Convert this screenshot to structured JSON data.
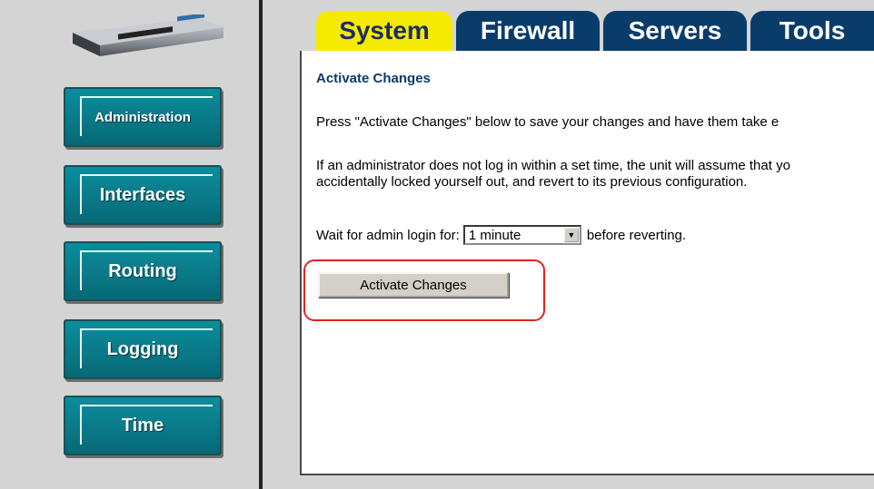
{
  "sidebar": {
    "items": [
      {
        "label": "Administration"
      },
      {
        "label": "Interfaces"
      },
      {
        "label": "Routing"
      },
      {
        "label": "Logging"
      },
      {
        "label": "Time"
      }
    ]
  },
  "tabs": [
    {
      "label": "System",
      "active": true
    },
    {
      "label": "Firewall",
      "active": false
    },
    {
      "label": "Servers",
      "active": false
    },
    {
      "label": "Tools",
      "active": false
    }
  ],
  "main": {
    "heading": "Activate Changes",
    "paragraph1": "Press \"Activate Changes\" below to save your changes and have them take e",
    "paragraph2_line1": "If an administrator does not log in within a set time, the unit will assume that yo",
    "paragraph2_line2": "accidentally locked yourself out, and revert to its previous configuration.",
    "wait_prefix": "Wait for admin login for:",
    "wait_select_value": "1 minute",
    "wait_suffix": "before reverting.",
    "activate_button": "Activate Changes"
  },
  "colors": {
    "tab_active": "#f5eb00",
    "tab_inactive": "#0a3c6a",
    "nav_button": "#0a8f9e",
    "heading": "#0b3a6d",
    "highlight": "#e0241e"
  }
}
